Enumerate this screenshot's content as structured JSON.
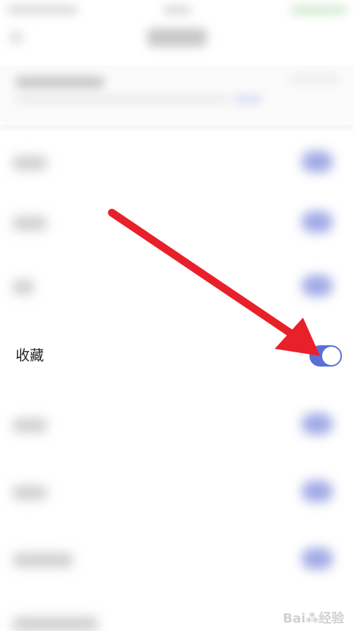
{
  "settings": {
    "focused_item": {
      "label": "收藏",
      "enabled": true
    }
  },
  "colors": {
    "toggle_on": "#5a6fd6",
    "arrow": "#e8202a"
  },
  "icons": {
    "annotation": "red-arrow-icon",
    "watermark": "baidu-jingyan-logo"
  }
}
